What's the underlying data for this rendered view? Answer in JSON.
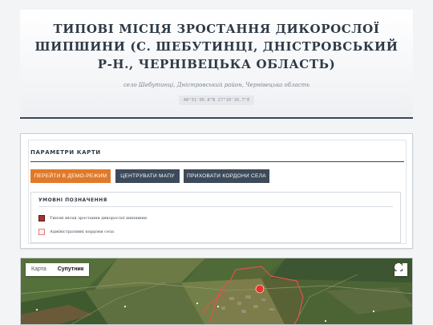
{
  "header": {
    "title": "ТИПОВІ МІСЦЯ ЗРОСТАННЯ ДИКОРОСЛОЇ ШИПШИНИ (С. ШЕБУТИНЦІ, ДНІСТРОВСЬКИЙ Р-Н., ЧЕРНІВЕЦЬКА ОБЛАСТЬ)",
    "subtitle": "село Шебутинці, Дністровський район, Чернівецька область",
    "coords": "48°31'06.8\"N 27°10'16.7\"E"
  },
  "params": {
    "title": "ПАРАМЕТРИ КАРТИ",
    "buttons": {
      "demo": "ПЕРЕЙТИ В ДЕМО-РЕЖИМ",
      "center": "ЦЕНТРУВАТИ МАПУ",
      "hide": "ПРИХОВАТИ КОРДОНИ СЕЛА"
    },
    "legend": {
      "title": "УМОВНІ ПОЗНАЧЕННЯ",
      "items": [
        {
          "label": "Типові місця зростання дикорослої шипшини",
          "color": "#a83232"
        },
        {
          "label": "Адміністративні кордони села",
          "color": "#e08080"
        }
      ]
    }
  },
  "map": {
    "type_options": [
      "Карта",
      "Супутник"
    ],
    "active_type": "Супутник",
    "fullscreen_icon": "fullscreen-icon",
    "marker_color": "#e8332b",
    "boundary_color": "#e0534a"
  }
}
